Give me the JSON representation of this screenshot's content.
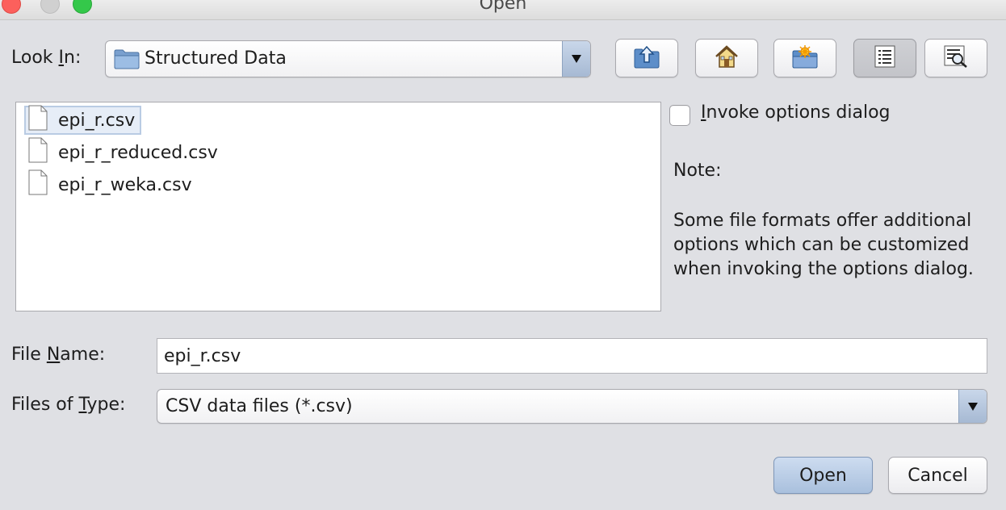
{
  "window": {
    "title": "Open"
  },
  "look_in": {
    "label_prefix": "Look ",
    "label_mnemonic": "I",
    "label_suffix": "n:",
    "value": "Structured Data",
    "folder_icon": "folder-icon"
  },
  "toolbar": {
    "buttons": [
      {
        "name": "up-one-level",
        "icon": "folder-up-icon"
      },
      {
        "name": "home",
        "icon": "home-icon"
      },
      {
        "name": "new-folder",
        "icon": "new-folder-icon"
      },
      {
        "name": "list-view",
        "icon": "list-icon",
        "pressed": true
      },
      {
        "name": "details-view",
        "icon": "details-icon"
      }
    ]
  },
  "files": [
    {
      "name": "epi_r.csv",
      "selected": true
    },
    {
      "name": "epi_r_reduced.csv",
      "selected": false
    },
    {
      "name": "epi_r_weka.csv",
      "selected": false
    }
  ],
  "options": {
    "checkbox_mnemonic": "I",
    "checkbox_label_rest": "nvoke options dialog",
    "checked": false,
    "note_title": "Note:",
    "note_lines": [
      "Some file formats offer additional",
      "options which can be customized",
      "when invoking the options dialog."
    ]
  },
  "file_name": {
    "label_prefix": "File ",
    "label_mnemonic": "N",
    "label_suffix": "ame:",
    "value": "epi_r.csv"
  },
  "files_of_type": {
    "label_prefix": "Files of ",
    "label_mnemonic": "T",
    "label_suffix": "ype:",
    "value": "CSV data files (*.csv)"
  },
  "buttons": {
    "open": "Open",
    "cancel": "Cancel"
  },
  "colors": {
    "background": "#dfe0e4",
    "default_button": "#b9cde6",
    "selection": "#e6edf7"
  }
}
